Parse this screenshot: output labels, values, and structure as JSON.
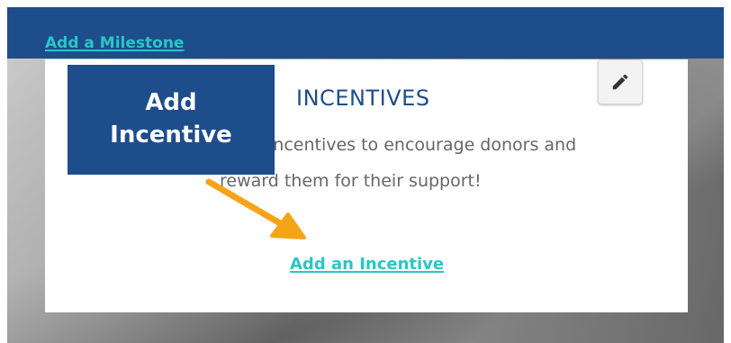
{
  "header": {
    "milestone_link": "Add a Milestone"
  },
  "callout": {
    "line1": "Add",
    "line2": "Incentive"
  },
  "incentives": {
    "title": "INCENTIVES",
    "description_line1": "incentives to encourage donors and",
    "description_line2": "reward them for their support!",
    "add_link": "Add an Incentive",
    "edit_icon": "pencil-icon"
  },
  "annotation": {
    "arrow_icon": "arrow-down-right-icon"
  },
  "colors": {
    "brand_blue": "#1e4d8b",
    "link_teal": "#2cc5c5",
    "arrow_orange": "#f5a418",
    "text_gray": "#666666"
  }
}
